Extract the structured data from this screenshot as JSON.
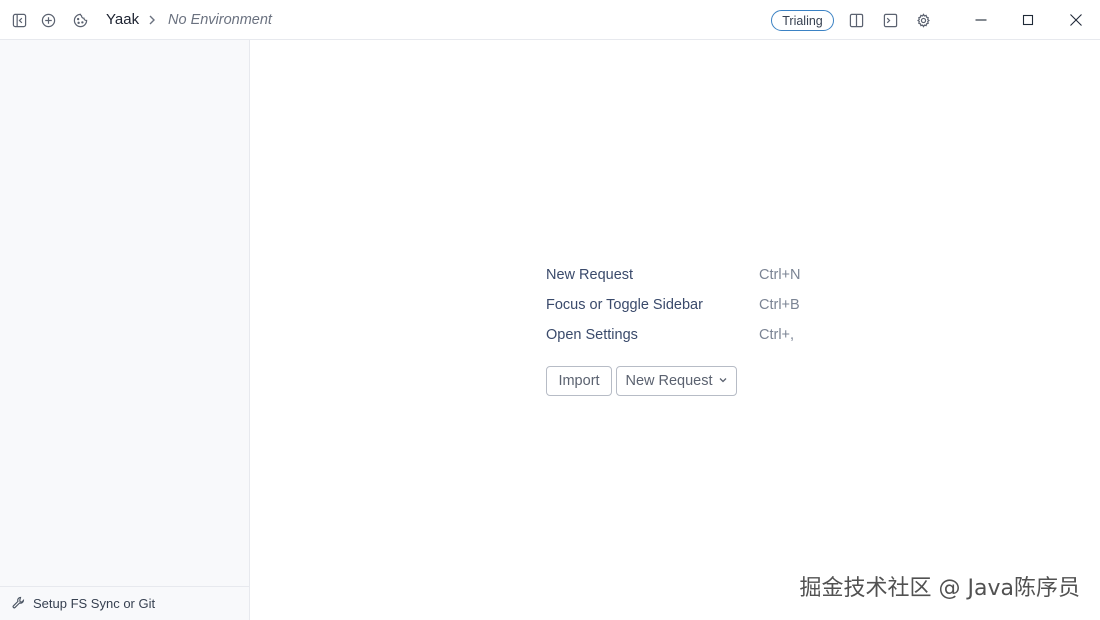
{
  "titlebar": {
    "workspace_name": "Yaak",
    "environment": "No Environment",
    "badge": "Trialing",
    "icons": [
      "sidebar-toggle-icon",
      "add-icon",
      "cookie-icon",
      "chevron-right-icon",
      "split-layout-icon",
      "terminal-icon",
      "settings-gear-icon"
    ],
    "window_controls": [
      "minimize-icon",
      "maximize-icon",
      "close-icon"
    ]
  },
  "sidebar": {
    "footer_label": "Setup FS Sync or Git",
    "footer_icon": "wrench-icon"
  },
  "main": {
    "shortcuts": [
      {
        "label": "New Request",
        "keys": "Ctrl+N"
      },
      {
        "label": "Focus or Toggle Sidebar",
        "keys": "Ctrl+B"
      },
      {
        "label": "Open Settings",
        "keys": "Ctrl+,"
      }
    ],
    "import_button": "Import",
    "new_request_button": "New Request"
  },
  "watermark": "掘金技术社区 @ Java陈序员",
  "colors": {
    "accent": "#3b82c4",
    "sidebar_bg": "#f8f9fb",
    "border": "#e7e9ee"
  }
}
